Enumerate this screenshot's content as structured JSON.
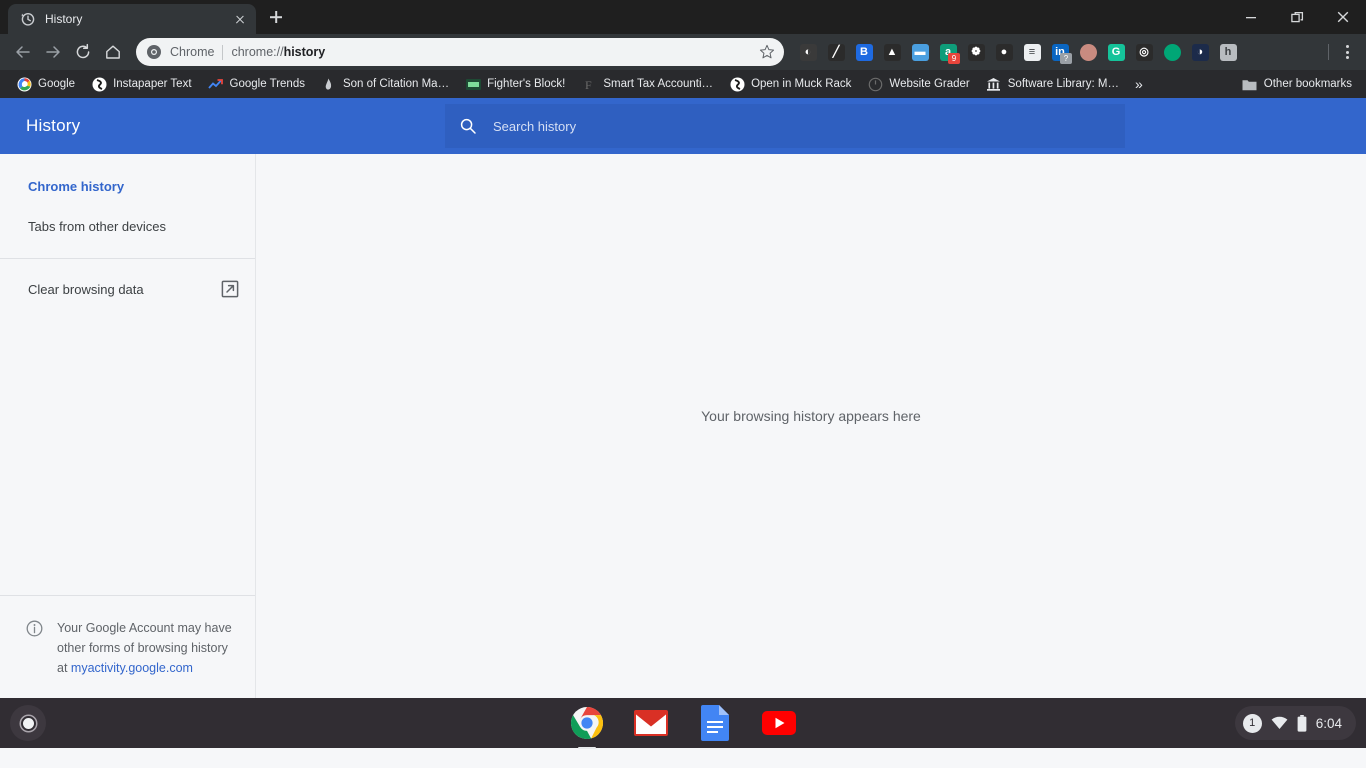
{
  "window": {
    "controls": [
      {
        "name": "minimize",
        "label": "Minimize"
      },
      {
        "name": "restore",
        "label": "Restore"
      },
      {
        "name": "close",
        "label": "Close"
      }
    ]
  },
  "tabs": [
    {
      "title": "History",
      "favicon": "history-clock-icon",
      "active": true
    }
  ],
  "newtab_label": "+",
  "toolbar": {
    "back_label": "Back",
    "forward_label": "Forward",
    "reload_label": "Reload",
    "home_label": "Home",
    "omnibox": {
      "chip_label": "Chrome",
      "url_prefix": "chrome://",
      "url_bold": "history",
      "full_url": "chrome://history",
      "star_label": "Bookmark this tab"
    },
    "menu_label": "Customize and control Google Chrome",
    "extensions": [
      {
        "name": "pocket-extension",
        "color": "#3a3a3a",
        "glyph": "◐",
        "badge": "",
        "badge_color": ""
      },
      {
        "name": "highlighter-extension",
        "color": "#2b2b2b",
        "glyph": "╱",
        "badge": "",
        "badge_color": ""
      },
      {
        "name": "bitly-extension",
        "color": "#1e6ae1",
        "glyph": "B",
        "badge": "",
        "badge_color": ""
      },
      {
        "name": "google-drive-extension",
        "color": "#2b2b2b",
        "glyph": "▲",
        "badge": "",
        "badge_color": ""
      },
      {
        "name": "window-extension",
        "color": "#4a9fe0",
        "glyph": "▬",
        "badge": "",
        "badge_color": ""
      },
      {
        "name": "grammar-extension",
        "color": "#0f9d7a",
        "glyph": "a",
        "badge": "9",
        "badge_color": "#e8453c"
      },
      {
        "name": "squirrel-extension",
        "color": "#2b2b2b",
        "glyph": "❁",
        "badge": "",
        "badge_color": ""
      },
      {
        "name": "ninja-extension",
        "color": "#2b2b2b",
        "glyph": "●",
        "badge": "",
        "badge_color": ""
      },
      {
        "name": "evernote-extension",
        "color": "#eceff1",
        "glyph": "≡",
        "badge": "",
        "badge_color": ""
      },
      {
        "name": "linkedin-extension",
        "color": "#0a66c2",
        "glyph": "in",
        "badge": "?",
        "badge_color": "#9aa0a6"
      },
      {
        "name": "circle-extension",
        "color": "#c98b80",
        "glyph": "",
        "badge": "",
        "badge_color": ""
      },
      {
        "name": "grammarly-extension",
        "color": "#15c39a",
        "glyph": "G",
        "badge": "",
        "badge_color": ""
      },
      {
        "name": "mailtrack-extension",
        "color": "#2b2b2b",
        "glyph": "◎",
        "badge": "",
        "badge_color": ""
      },
      {
        "name": "location-pin-extension",
        "color": "#00a676",
        "glyph": "",
        "badge": "",
        "badge_color": ""
      },
      {
        "name": "semrush-extension",
        "color": "#1c2b4a",
        "glyph": "◑",
        "badge": "",
        "badge_color": ""
      },
      {
        "name": "hubspot-extension",
        "color": "#b8bcc0",
        "glyph": "h",
        "badge": "",
        "badge_color": ""
      }
    ]
  },
  "bookmarks": {
    "items": [
      {
        "label": "Google",
        "icon": "google-favicon"
      },
      {
        "label": "Instapaper Text",
        "icon": "instapaper-favicon"
      },
      {
        "label": "Google Trends",
        "icon": "trends-favicon"
      },
      {
        "label": "Son of Citation Ma…",
        "icon": "citation-machine-favicon"
      },
      {
        "label": "Fighter's Block!",
        "icon": "fighters-block-favicon"
      },
      {
        "label": "Smart Tax Accounti…",
        "icon": "smart-tax-favicon"
      },
      {
        "label": "Open in Muck Rack",
        "icon": "muckrack-favicon"
      },
      {
        "label": "Website Grader",
        "icon": "website-grader-favicon"
      },
      {
        "label": "Software Library: M…",
        "icon": "software-library-favicon"
      }
    ],
    "overflow_label": "»",
    "other_bookmarks_label": "Other bookmarks"
  },
  "history_page": {
    "title": "History",
    "search_placeholder": "Search history",
    "search_value": "",
    "sidebar": {
      "items": [
        {
          "label": "Chrome history",
          "active": true
        },
        {
          "label": "Tabs from other devices",
          "active": false
        }
      ],
      "clear_browsing_data_label": "Clear browsing data",
      "footer_text_line1": "Your Google Account may have",
      "footer_text_line2": "other forms of browsing history",
      "footer_text_prefix": "at ",
      "footer_link": "myactivity.google.com"
    },
    "empty_message": "Your browsing history appears here"
  },
  "shelf": {
    "launcher_label": "Launcher",
    "apps": [
      {
        "name": "chrome",
        "label": "Chrome",
        "running": true
      },
      {
        "name": "gmail",
        "label": "Gmail",
        "running": false
      },
      {
        "name": "docs",
        "label": "Google Docs",
        "running": false
      },
      {
        "name": "youtube",
        "label": "YouTube",
        "running": false
      }
    ],
    "tray": {
      "notification_count": "1",
      "network_label": "Wi-Fi",
      "battery_label": "Battery",
      "time": "6:04"
    }
  },
  "colors": {
    "header_blue": "#3366cc",
    "search_blue": "#2f5fc0",
    "link_blue": "#3366cc",
    "page_bg": "#f6f7f9",
    "toolbar_dark": "#323639",
    "tabstrip_dark": "#1f1f1f",
    "bookmarks_dark": "#292a2d",
    "shelf_dark": "#312d33"
  }
}
